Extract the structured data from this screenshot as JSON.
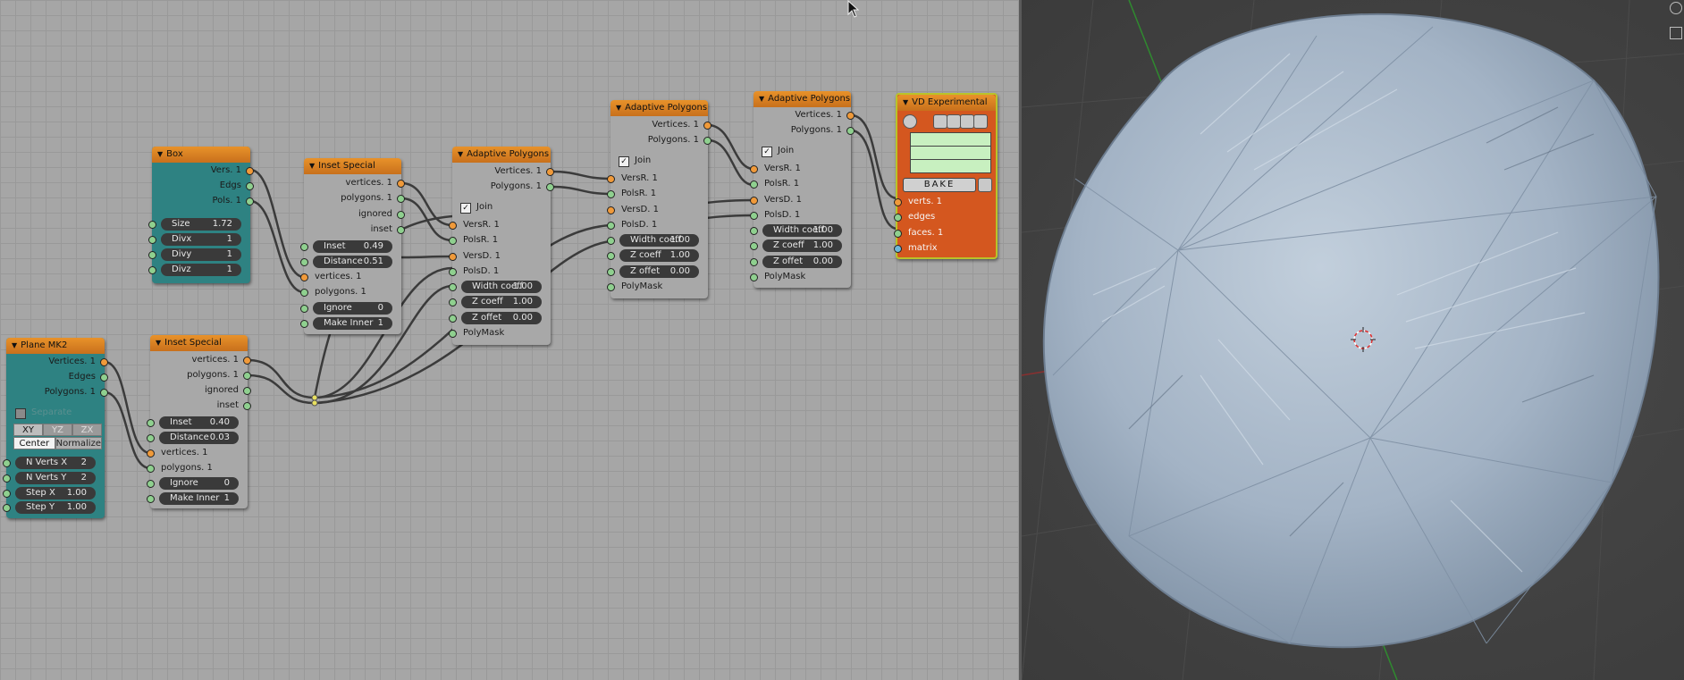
{
  "nodes": {
    "box": {
      "title": "Box",
      "outputs": [
        "Vers. 1",
        "Edgs",
        "Pols. 1"
      ],
      "fields": [
        {
          "label": "Size",
          "value": "1.72"
        },
        {
          "label": "Divx",
          "value": "1"
        },
        {
          "label": "Divy",
          "value": "1"
        },
        {
          "label": "Divz",
          "value": "1"
        }
      ]
    },
    "inset1": {
      "title": "Inset Special",
      "outputs": [
        "vertices. 1",
        "polygons. 1",
        "ignored",
        "inset"
      ],
      "fields_top": [
        {
          "label": "Inset",
          "value": "0.49"
        },
        {
          "label": "Distance",
          "value": "0.51"
        }
      ],
      "inputs": [
        "vertices. 1",
        "polygons. 1"
      ],
      "fields_bottom": [
        {
          "label": "Ignore",
          "value": "0"
        },
        {
          "label": "Make Inner",
          "value": "1"
        }
      ]
    },
    "adapt1": {
      "title": "Adaptive Polygons ...",
      "outputs": [
        "Vertices. 1",
        "Polygons. 1"
      ],
      "join": "Join",
      "inputs": [
        "VersR. 1",
        "PolsR. 1",
        "VersD. 1",
        "PolsD. 1"
      ],
      "fields": [
        {
          "label": "Width coeff",
          "value": "1.00"
        },
        {
          "label": "Z coeff",
          "value": "1.00"
        },
        {
          "label": "Z offet",
          "value": "0.00"
        }
      ],
      "mask": "PolyMask"
    },
    "adapt2": {
      "title": "Adaptive Polygons ...",
      "outputs": [
        "Vertices. 1",
        "Polygons. 1"
      ],
      "join": "Join",
      "inputs": [
        "VersR. 1",
        "PolsR. 1",
        "VersD. 1",
        "PolsD. 1"
      ],
      "fields": [
        {
          "label": "Width coeff",
          "value": "1.00"
        },
        {
          "label": "Z coeff",
          "value": "1.00"
        },
        {
          "label": "Z offet",
          "value": "0.00"
        }
      ],
      "mask": "PolyMask"
    },
    "adapt3": {
      "title": "Adaptive Polygons ...",
      "outputs": [
        "Vertices. 1",
        "Polygons. 1"
      ],
      "join": "Join",
      "inputs": [
        "VersR. 1",
        "PolsR. 1",
        "VersD. 1",
        "PolsD. 1"
      ],
      "fields": [
        {
          "label": "Width coeff",
          "value": "1.00"
        },
        {
          "label": "Z coeff",
          "value": "1.00"
        },
        {
          "label": "Z offet",
          "value": "0.00"
        }
      ],
      "mask": "PolyMask"
    },
    "vd": {
      "title": "VD Experimental",
      "bake": "BAKE",
      "inputs": [
        "verts. 1",
        "edges",
        "faces. 1",
        "matrix"
      ]
    },
    "plane": {
      "title": "Plane MK2",
      "outputs": [
        "Vertices. 1",
        "Edges",
        "Polygons. 1"
      ],
      "separate": "Separate",
      "axes": [
        "XY",
        "YZ",
        "ZX"
      ],
      "modes": [
        "Center",
        "Normalize"
      ],
      "fields": [
        {
          "label": "N Verts X",
          "value": "2"
        },
        {
          "label": "N Verts Y",
          "value": "2"
        },
        {
          "label": "Step X",
          "value": "1.00"
        },
        {
          "label": "Step Y",
          "value": "1.00"
        }
      ]
    },
    "inset2": {
      "title": "Inset Special",
      "outputs": [
        "vertices. 1",
        "polygons. 1",
        "ignored",
        "inset"
      ],
      "fields_top": [
        {
          "label": "Inset",
          "value": "0.40"
        },
        {
          "label": "Distance",
          "value": "0.03"
        }
      ],
      "inputs": [
        "vertices. 1",
        "polygons. 1"
      ],
      "fields_bottom": [
        {
          "label": "Ignore",
          "value": "0"
        },
        {
          "label": "Make Inner",
          "value": "1"
        }
      ]
    }
  },
  "colors": {
    "node_header": "#e8922a",
    "teal_node": "#2e8282",
    "viewer_node": "#d4571f",
    "mesh": "#a9b8c9",
    "viewport_bg": "#414141"
  }
}
